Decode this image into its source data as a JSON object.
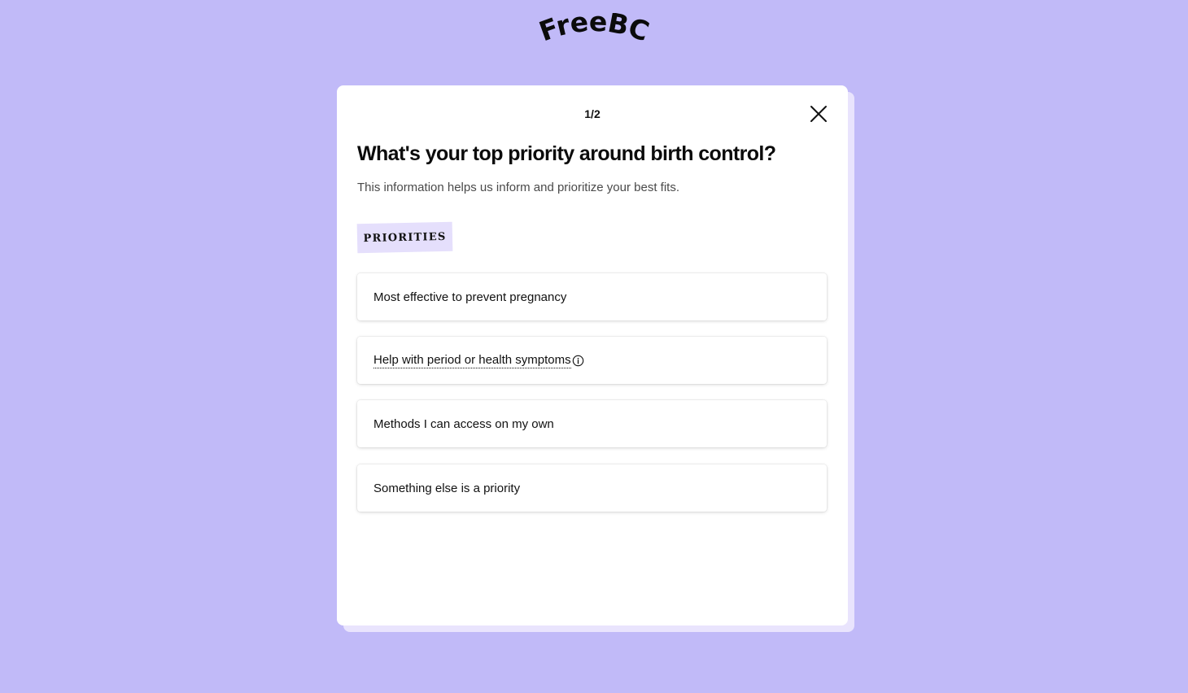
{
  "app": {
    "logo_text": "FreeBC"
  },
  "colors": {
    "background": "#c1baf8",
    "card": "#ffffff",
    "card_shadow": "#e9e4fd",
    "tag_bg": "#e5dffc"
  },
  "modal": {
    "step": "1/2",
    "close_icon": "close-icon",
    "title": "What's your top priority around birth control?",
    "subtitle": "This information helps us inform and prioritize your best fits.",
    "tag": "PRIORITIES",
    "options": [
      {
        "label": "Most effective to prevent pregnancy"
      },
      {
        "label": "Help with period or health symptoms",
        "icon": "info-icon"
      },
      {
        "label": "Methods I can access on my own"
      },
      {
        "label": "Something else is a priority"
      }
    ]
  }
}
